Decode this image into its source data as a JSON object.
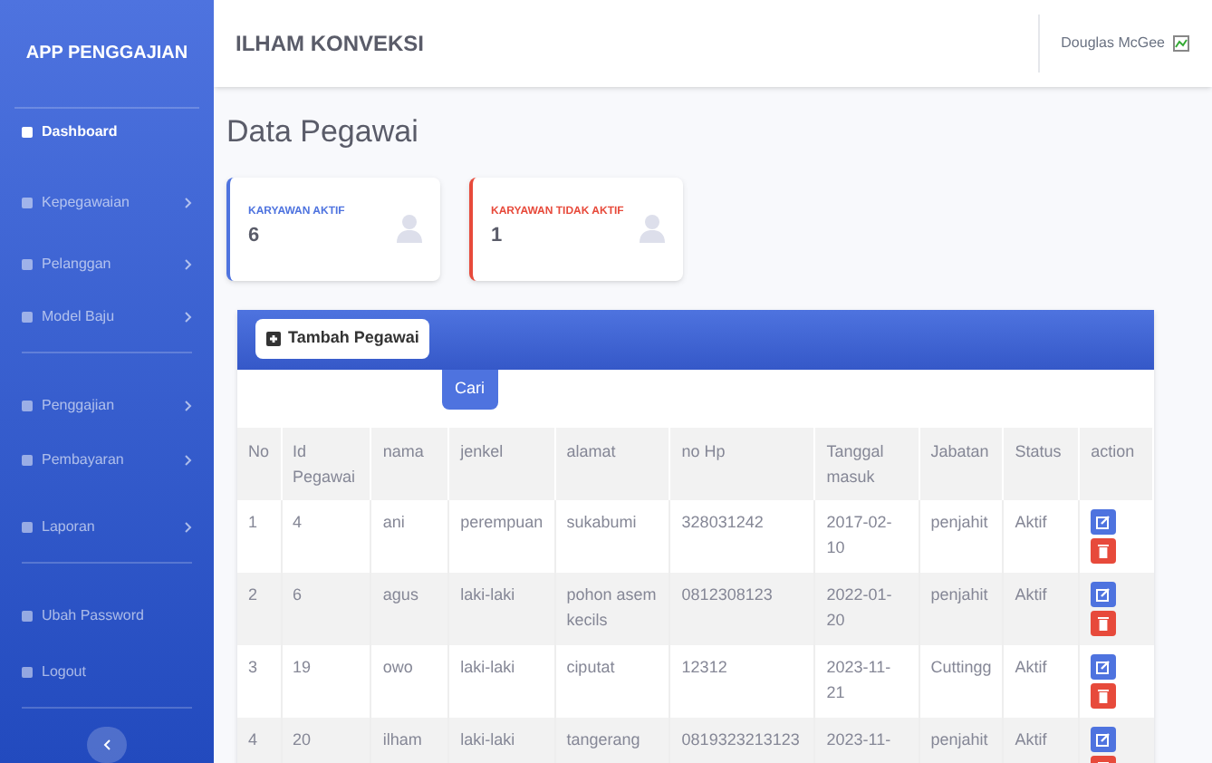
{
  "sidebar": {
    "brand": "APP PENGGAJIAN",
    "items": [
      {
        "label": "Dashboard",
        "selected": true,
        "collapsible": false,
        "divider_after": false
      },
      {
        "label": "Kepegawaian",
        "selected": false,
        "collapsible": true,
        "divider_after": false
      },
      {
        "label": "Pelanggan",
        "selected": false,
        "collapsible": true,
        "divider_after": false
      },
      {
        "label": "Model Baju",
        "selected": false,
        "collapsible": true,
        "divider_after": true
      },
      {
        "label": "Penggajian",
        "selected": false,
        "collapsible": true,
        "divider_after": false
      },
      {
        "label": "Pembayaran",
        "selected": false,
        "collapsible": true,
        "divider_after": false
      },
      {
        "label": "Laporan",
        "selected": false,
        "collapsible": true,
        "divider_after": true
      },
      {
        "label": "Ubah Password",
        "selected": false,
        "collapsible": false,
        "divider_after": false
      },
      {
        "label": "Logout",
        "selected": false,
        "collapsible": false,
        "divider_after": true
      }
    ]
  },
  "topbar": {
    "title": "ILHAM KONVEKSI",
    "user": "Douglas McGee"
  },
  "page_title": "Data Pegawai",
  "stat_cards": [
    {
      "label": "KARYAWAN AKTIF",
      "value": "6",
      "color": "#4e73df"
    },
    {
      "label": "KARYAWAN TIDAK AKTIF",
      "value": "1",
      "color": "#e74a3b"
    }
  ],
  "add_button": "Tambah Pegawai",
  "search_button": "Cari",
  "table": {
    "columns": [
      "No",
      "Id Pegawai",
      "nama",
      "jenkel",
      "alamat",
      "no Hp",
      "Tanggal masuk",
      "Jabatan",
      "Status",
      "action"
    ],
    "rows": [
      [
        "1",
        "4",
        "ani",
        "perempuan",
        "sukabumi",
        "328031242",
        "2017-02-10",
        "penjahit",
        "Aktif"
      ],
      [
        "2",
        "6",
        "agus",
        "laki-laki",
        "pohon asem kecils",
        "0812308123",
        "2022-01-20",
        "penjahit",
        "Aktif"
      ],
      [
        "3",
        "19",
        "owo",
        "laki-laki",
        "ciputat",
        "12312",
        "2023-11-21",
        "Cuttingg",
        "Aktif"
      ],
      [
        "4",
        "20",
        "ilham",
        "laki-laki",
        "tangerang",
        "0819323213123",
        "2023-11-",
        "penjahit",
        "Aktif"
      ]
    ]
  }
}
